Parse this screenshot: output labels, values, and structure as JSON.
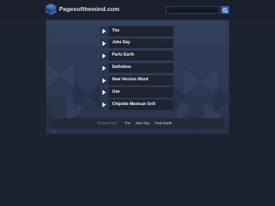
{
  "header": {
    "site_name": "Pagesofthemind.com",
    "search": {
      "value": "",
      "placeholder": ""
    }
  },
  "links": [
    {
      "label": "The"
    },
    {
      "label": "Joke Day"
    },
    {
      "label": "Parts Earth"
    },
    {
      "label": "Definition"
    },
    {
      "label": "New Version Word"
    },
    {
      "label": "Use"
    },
    {
      "label": "Chipotle Mexican Grill"
    }
  ],
  "related": {
    "title": "Related links",
    "links": [
      "The",
      "Joke Day",
      "Parts Earth"
    ]
  },
  "colors": {
    "background": "#1c2230",
    "panel": "#2e3a52",
    "link_box": "#1d2331",
    "accent": "#3d6bb4"
  },
  "icons": {
    "logo": "stacked-cube-icon",
    "search": "search-icon",
    "link_arrow": "play-arrow-icon"
  }
}
